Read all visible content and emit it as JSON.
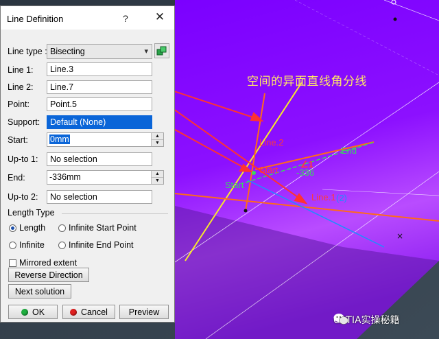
{
  "dialog": {
    "title": "Line Definition",
    "help_glyph": "?",
    "close_glyph": "✕",
    "line_type": {
      "label": "Line type :",
      "value": "Bisecting"
    },
    "line1": {
      "label": "Line 1:",
      "value": "Line.3"
    },
    "line2": {
      "label": "Line 2:",
      "value": "Line.7"
    },
    "point": {
      "label": "Point:",
      "value": "Point.5"
    },
    "support": {
      "label": "Support:",
      "value": "Default (None)"
    },
    "start": {
      "label": "Start:",
      "value": "0mm"
    },
    "upto1": {
      "label": "Up-to 1:",
      "value": "No selection"
    },
    "end": {
      "label": "End:",
      "value": "-336mm"
    },
    "upto2": {
      "label": "Up-to 2:",
      "value": "No selection"
    },
    "length_type": {
      "title": "Length Type",
      "options": [
        "Length",
        "Infinite Start Point",
        "Infinite",
        "Infinite End Point"
      ],
      "selected": "Length"
    },
    "mirrored_extent": {
      "label": "Mirrored extent",
      "checked": false
    },
    "buttons": {
      "reverse": "Reverse Direction",
      "next": "Next solution",
      "ok": "OK",
      "cancel": "Cancel",
      "preview": "Preview"
    },
    "icons": {
      "line_type_options": "sketch-tool-icon",
      "ok": "green-dot-icon",
      "cancel": "red-dot-icon"
    }
  },
  "viewport": {
    "annotation": "空间的异面直线角分线",
    "labels": {
      "line2": "Line.2",
      "start": "Start",
      "end": "End",
      "line1": "Line.1",
      "subscript": "(2)",
      "dimension": "-336",
      "angle": "∠1",
      "center": "Start"
    },
    "colors": {
      "surface": "#8a00ff",
      "line_orange": "#ff6a1a",
      "line_yellow": "#f7ea2a",
      "label_green": "#39d95c",
      "label_red": "#ff3a3a",
      "line_blue": "#1e8dff"
    }
  },
  "watermark": {
    "text": "CATIA实操秘籍"
  }
}
